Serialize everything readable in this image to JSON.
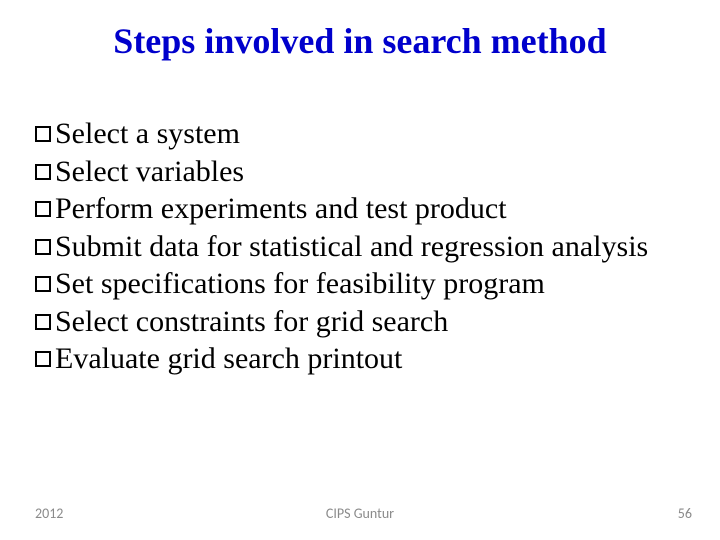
{
  "title": "Steps involved in search method",
  "items": [
    "Select a system",
    "Select variables",
    "Perform experiments and test product",
    "Submit data for statistical and regression analysis",
    "Set specifications for feasibility program",
    "Select constraints for grid search",
    "Evaluate grid search printout"
  ],
  "footer": {
    "year": "2012",
    "center": "CIPS Guntur",
    "page": "56"
  }
}
